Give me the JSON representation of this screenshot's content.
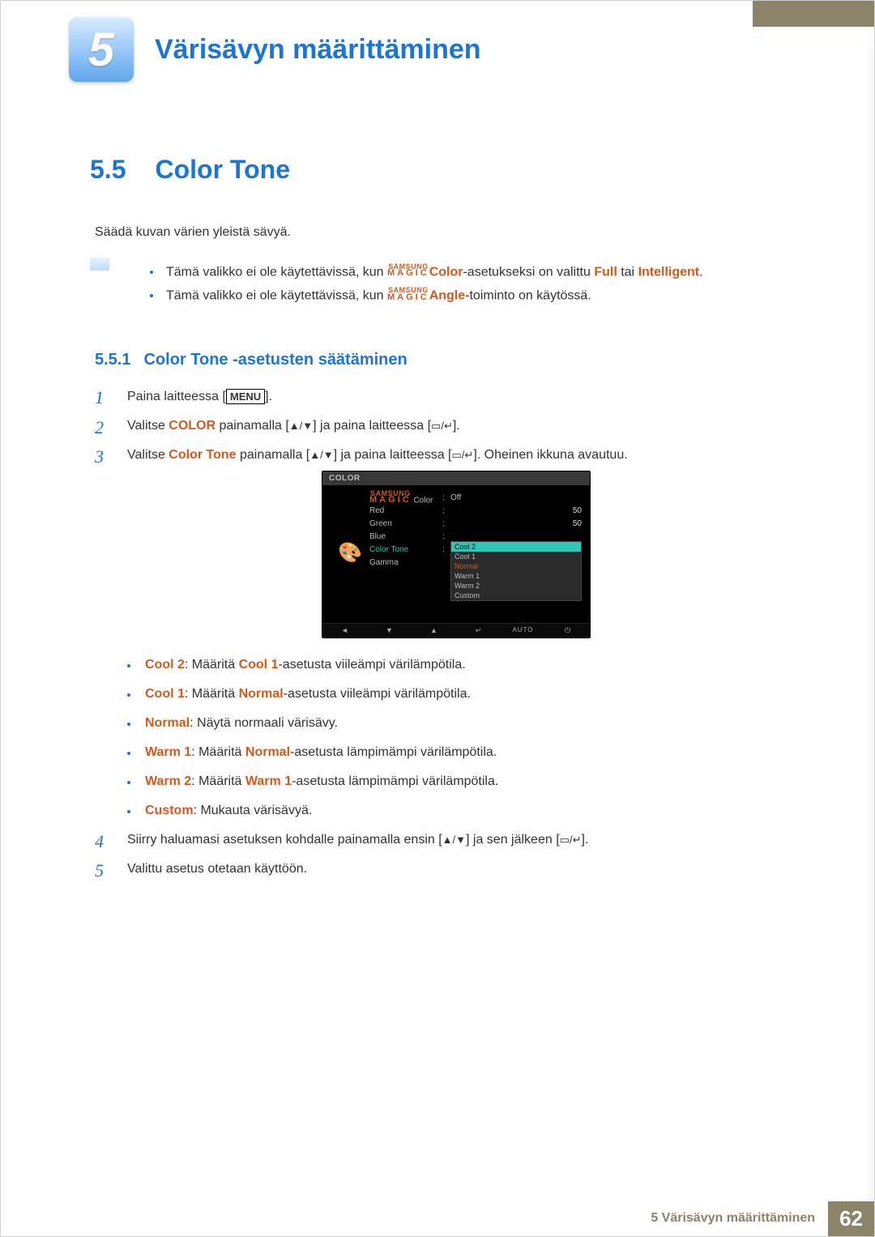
{
  "chapter": {
    "number": "5",
    "title": "Värisävyn määrittäminen"
  },
  "section": {
    "number": "5.5",
    "title": "Color Tone"
  },
  "intro": "Säädä kuvan värien yleistä sävyä.",
  "magic": {
    "top": "SAMSUNG",
    "bot": "MAGIC"
  },
  "notes": {
    "n1_a": "Tämä valikko ei ole käytettävissä, kun ",
    "n1_color": "Color",
    "n1_b": "-asetukseksi on valittu ",
    "n1_full": "Full",
    "n1_or": " tai ",
    "n1_intel": "Intelligent",
    "n1_end": ".",
    "n2_a": "Tämä valikko ei ole käytettävissä, kun ",
    "n2_angle": "Angle",
    "n2_b": "-toiminto on käytössä."
  },
  "subsection": {
    "number": "5.5.1",
    "title": "Color Tone -asetusten säätäminen"
  },
  "steps": {
    "s1_a": "Paina laitteessa [",
    "s1_menu": "MENU",
    "s1_b": "].",
    "s2_a": "Valitse ",
    "s2_color": "COLOR",
    "s2_b": " painamalla [",
    "s2_c": "] ja paina laitteessa [",
    "s2_d": "].",
    "s3_a": "Valitse ",
    "s3_ct": "Color Tone",
    "s3_b": " painamalla [",
    "s3_c": "] ja paina laitteessa [",
    "s3_d": "]. Oheinen ikkuna avautuu.",
    "s4_a": "Siirry haluamasi asetuksen kohdalle painamalla ensin [",
    "s4_b": "] ja sen jälkeen [",
    "s4_c": "].",
    "s5": "Valittu asetus otetaan käyttöön."
  },
  "osd": {
    "title": "COLOR",
    "palette_glyph": "🎨",
    "rows": {
      "magic": {
        "label": "Color",
        "val": "Off"
      },
      "red": {
        "label": "Red",
        "val": "50"
      },
      "green": {
        "label": "Green",
        "val": "50"
      },
      "blue": {
        "label": "Blue"
      },
      "color_tone": {
        "label": "Color Tone"
      },
      "gamma": {
        "label": "Gamma"
      }
    },
    "options": [
      "Cool 2",
      "Cool 1",
      "Normal",
      "Warm 1",
      "Warm 2",
      "Custom"
    ],
    "buttons": [
      "◄",
      "▼",
      "▲",
      "↵",
      "AUTO",
      "⏻"
    ]
  },
  "descs": {
    "d1_k": "Cool 2",
    "d1_a": ": Määritä ",
    "d1_k2": "Cool 1",
    "d1_b": "-asetusta viileämpi värilämpötila.",
    "d2_k": "Cool 1",
    "d2_a": ": Määritä ",
    "d2_k2": "Normal",
    "d2_b": "-asetusta viileämpi värilämpötila.",
    "d3_k": "Normal",
    "d3_a": ": Näytä normaali värisävy.",
    "d4_k": "Warm 1",
    "d4_a": ": Määritä ",
    "d4_k2": "Normal",
    "d4_b": "-asetusta lämpimämpi värilämpötila.",
    "d5_k": "Warm 2",
    "d5_a": ": Määritä ",
    "d5_k2": "Warm 1",
    "d5_b": "-asetusta lämpimämpi värilämpötila.",
    "d6_k": "Custom",
    "d6_a": ": Mukauta värisävyä."
  },
  "symbols": {
    "updown": "▲/▼",
    "rect": "▭",
    "slash": " / ",
    "enter": "↵"
  },
  "footer": {
    "text": "5 Värisävyn määrittäminen",
    "page": "62"
  }
}
